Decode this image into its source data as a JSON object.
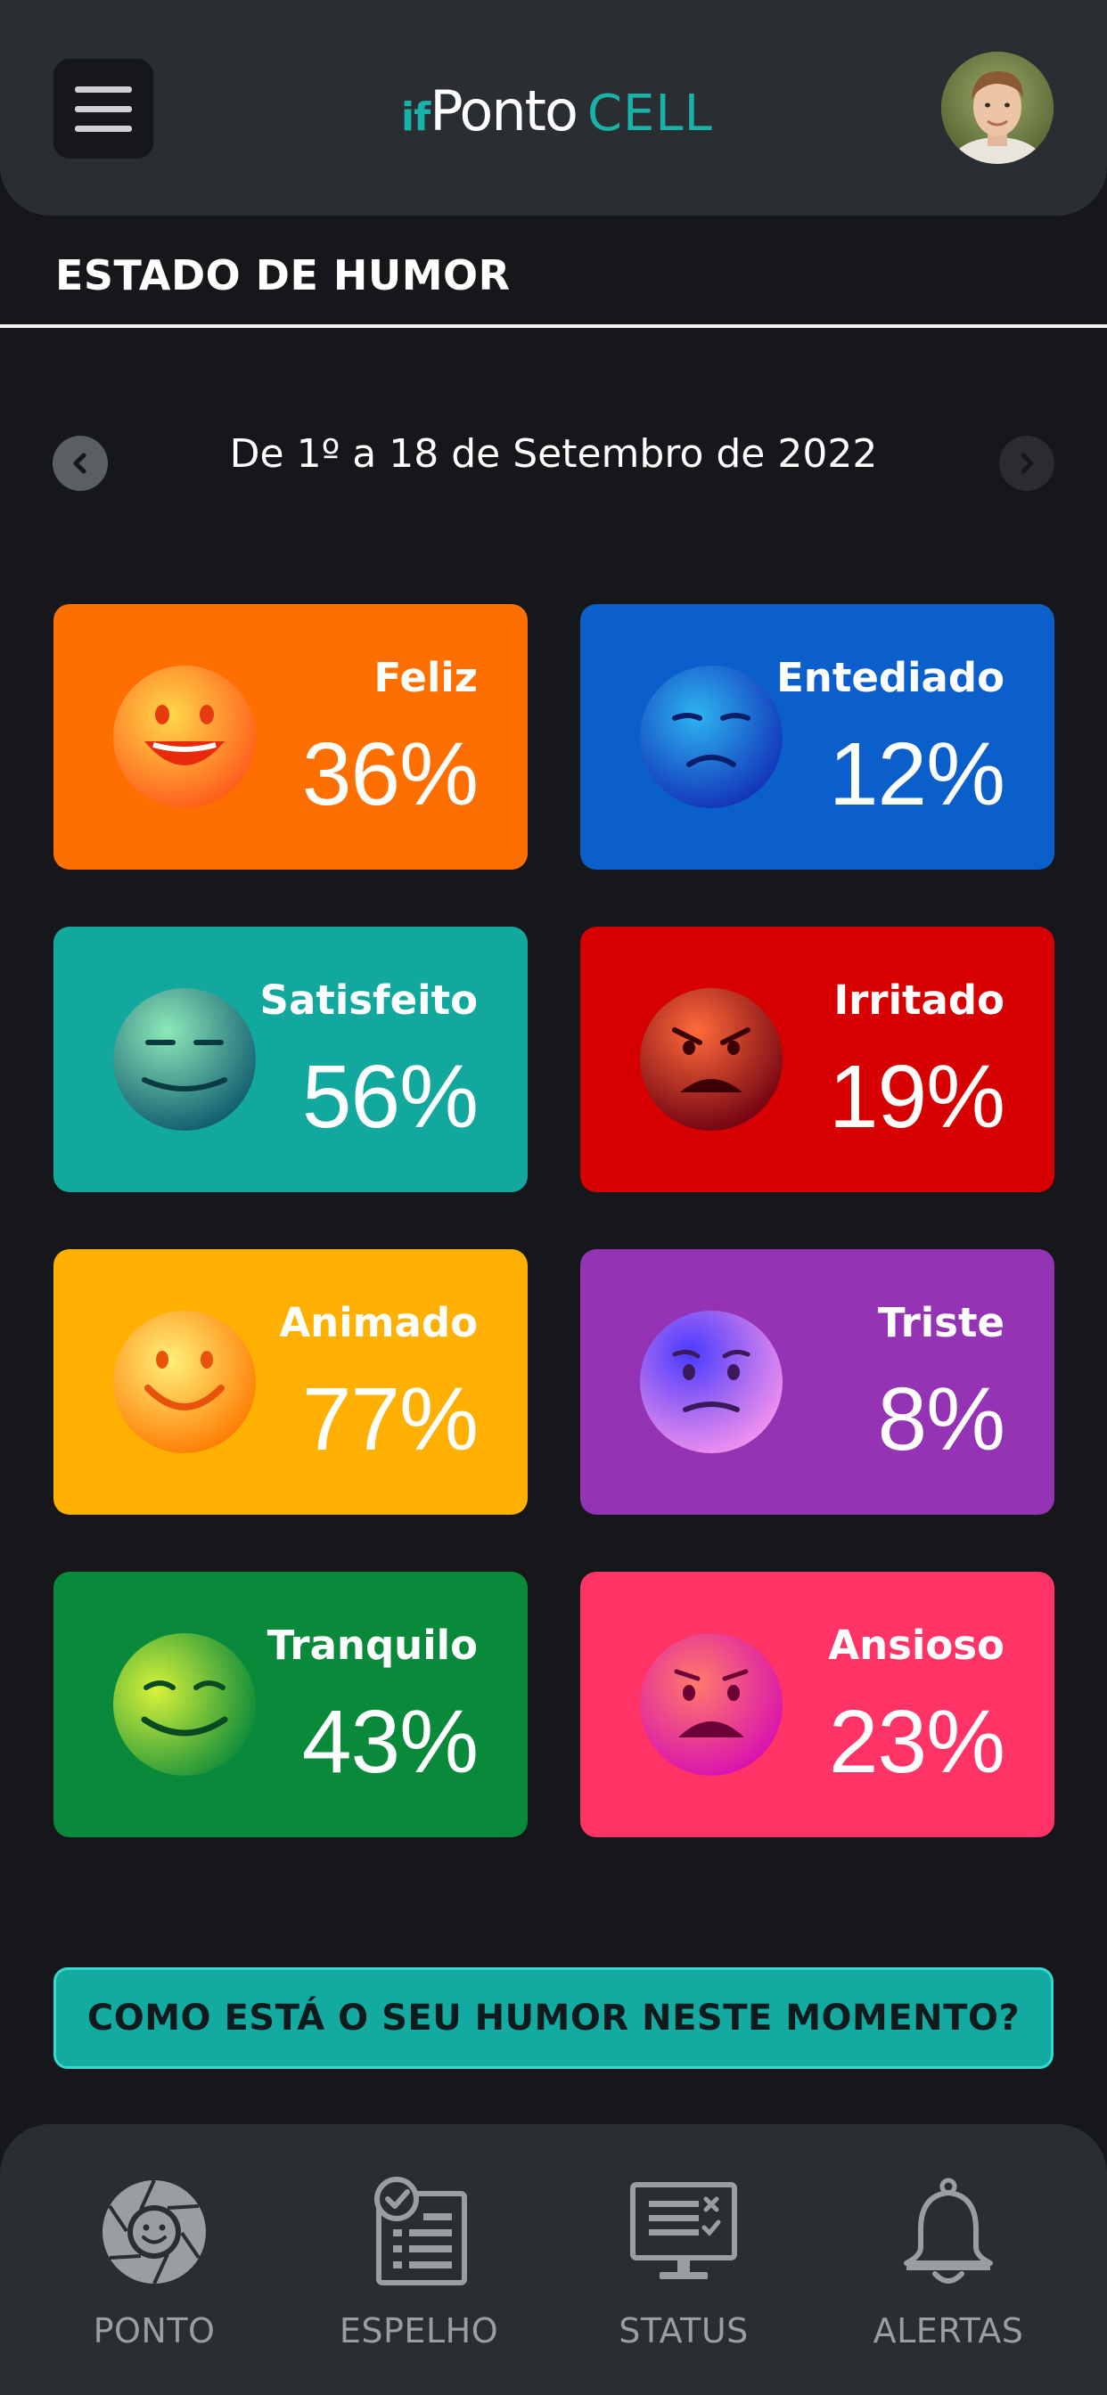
{
  "header": {
    "logo_if": "if",
    "logo_ponto": "Ponto",
    "logo_cell": "CELL",
    "menu_icon": "hamburger-menu-icon",
    "avatar": "user-avatar"
  },
  "section": {
    "title": "ESTADO DE HUMOR"
  },
  "date_nav": {
    "label": "De 1º a 18 de Setembro de 2022",
    "prev_icon": "chevron-left-icon",
    "next_icon": "chevron-right-icon"
  },
  "moods": [
    {
      "label": "Feliz",
      "percent": "36%",
      "color": "#ff6f00",
      "face": "happy-face-icon"
    },
    {
      "label": "Entediado",
      "percent": "12%",
      "color": "#0b5fca",
      "face": "bored-face-icon"
    },
    {
      "label": "Satisfeito",
      "percent": "56%",
      "color": "#12a89e",
      "face": "satisfied-face-icon"
    },
    {
      "label": "Irritado",
      "percent": "19%",
      "color": "#d70000",
      "face": "angry-face-icon"
    },
    {
      "label": "Animado",
      "percent": "77%",
      "color": "#ffb000",
      "face": "excited-face-icon"
    },
    {
      "label": "Triste",
      "percent": "8%",
      "color": "#9434b4",
      "face": "sad-face-icon"
    },
    {
      "label": "Tranquilo",
      "percent": "43%",
      "color": "#098a3a",
      "face": "calm-face-icon"
    },
    {
      "label": "Ansioso",
      "percent": "23%",
      "color": "#ff3366",
      "face": "anxious-face-icon"
    }
  ],
  "cta": {
    "label": "COMO ESTÁ O SEU HUMOR NESTE MOMENTO?"
  },
  "bottom_nav": [
    {
      "label": "PONTO",
      "icon": "camera-face-icon"
    },
    {
      "label": "ESPELHO",
      "icon": "checklist-document-icon"
    },
    {
      "label": "STATUS",
      "icon": "monitor-status-icon"
    },
    {
      "label": "ALERTAS",
      "icon": "bell-icon"
    }
  ]
}
